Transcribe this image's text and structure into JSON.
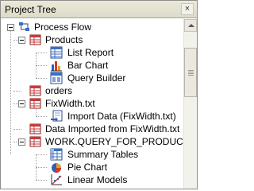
{
  "panel": {
    "title": "Project Tree",
    "close_label": "×"
  },
  "tree": {
    "root": {
      "label": "Process Flow",
      "icon": "process-flow-icon"
    },
    "nodes": [
      {
        "label": "Products",
        "icon": "data-table-icon"
      },
      {
        "label": "List Report",
        "icon": "list-report-icon"
      },
      {
        "label": "Bar Chart",
        "icon": "bar-chart-icon"
      },
      {
        "label": "Query Builder",
        "icon": "query-builder-icon"
      },
      {
        "label": "orders",
        "icon": "data-table-icon"
      },
      {
        "label": "FixWidth.txt",
        "icon": "data-table-icon"
      },
      {
        "label": "Import Data (FixWidth.txt)",
        "icon": "import-data-icon"
      },
      {
        "label": "Data Imported from FixWidth.txt",
        "icon": "data-table-icon"
      },
      {
        "label": "WORK.QUERY_FOR_PRODUCTS",
        "icon": "data-table-icon"
      },
      {
        "label": "Summary Tables",
        "icon": "summary-tables-icon"
      },
      {
        "label": "Pie Chart",
        "icon": "pie-chart-icon"
      },
      {
        "label": "Linear Models",
        "icon": "linear-models-icon"
      }
    ]
  }
}
